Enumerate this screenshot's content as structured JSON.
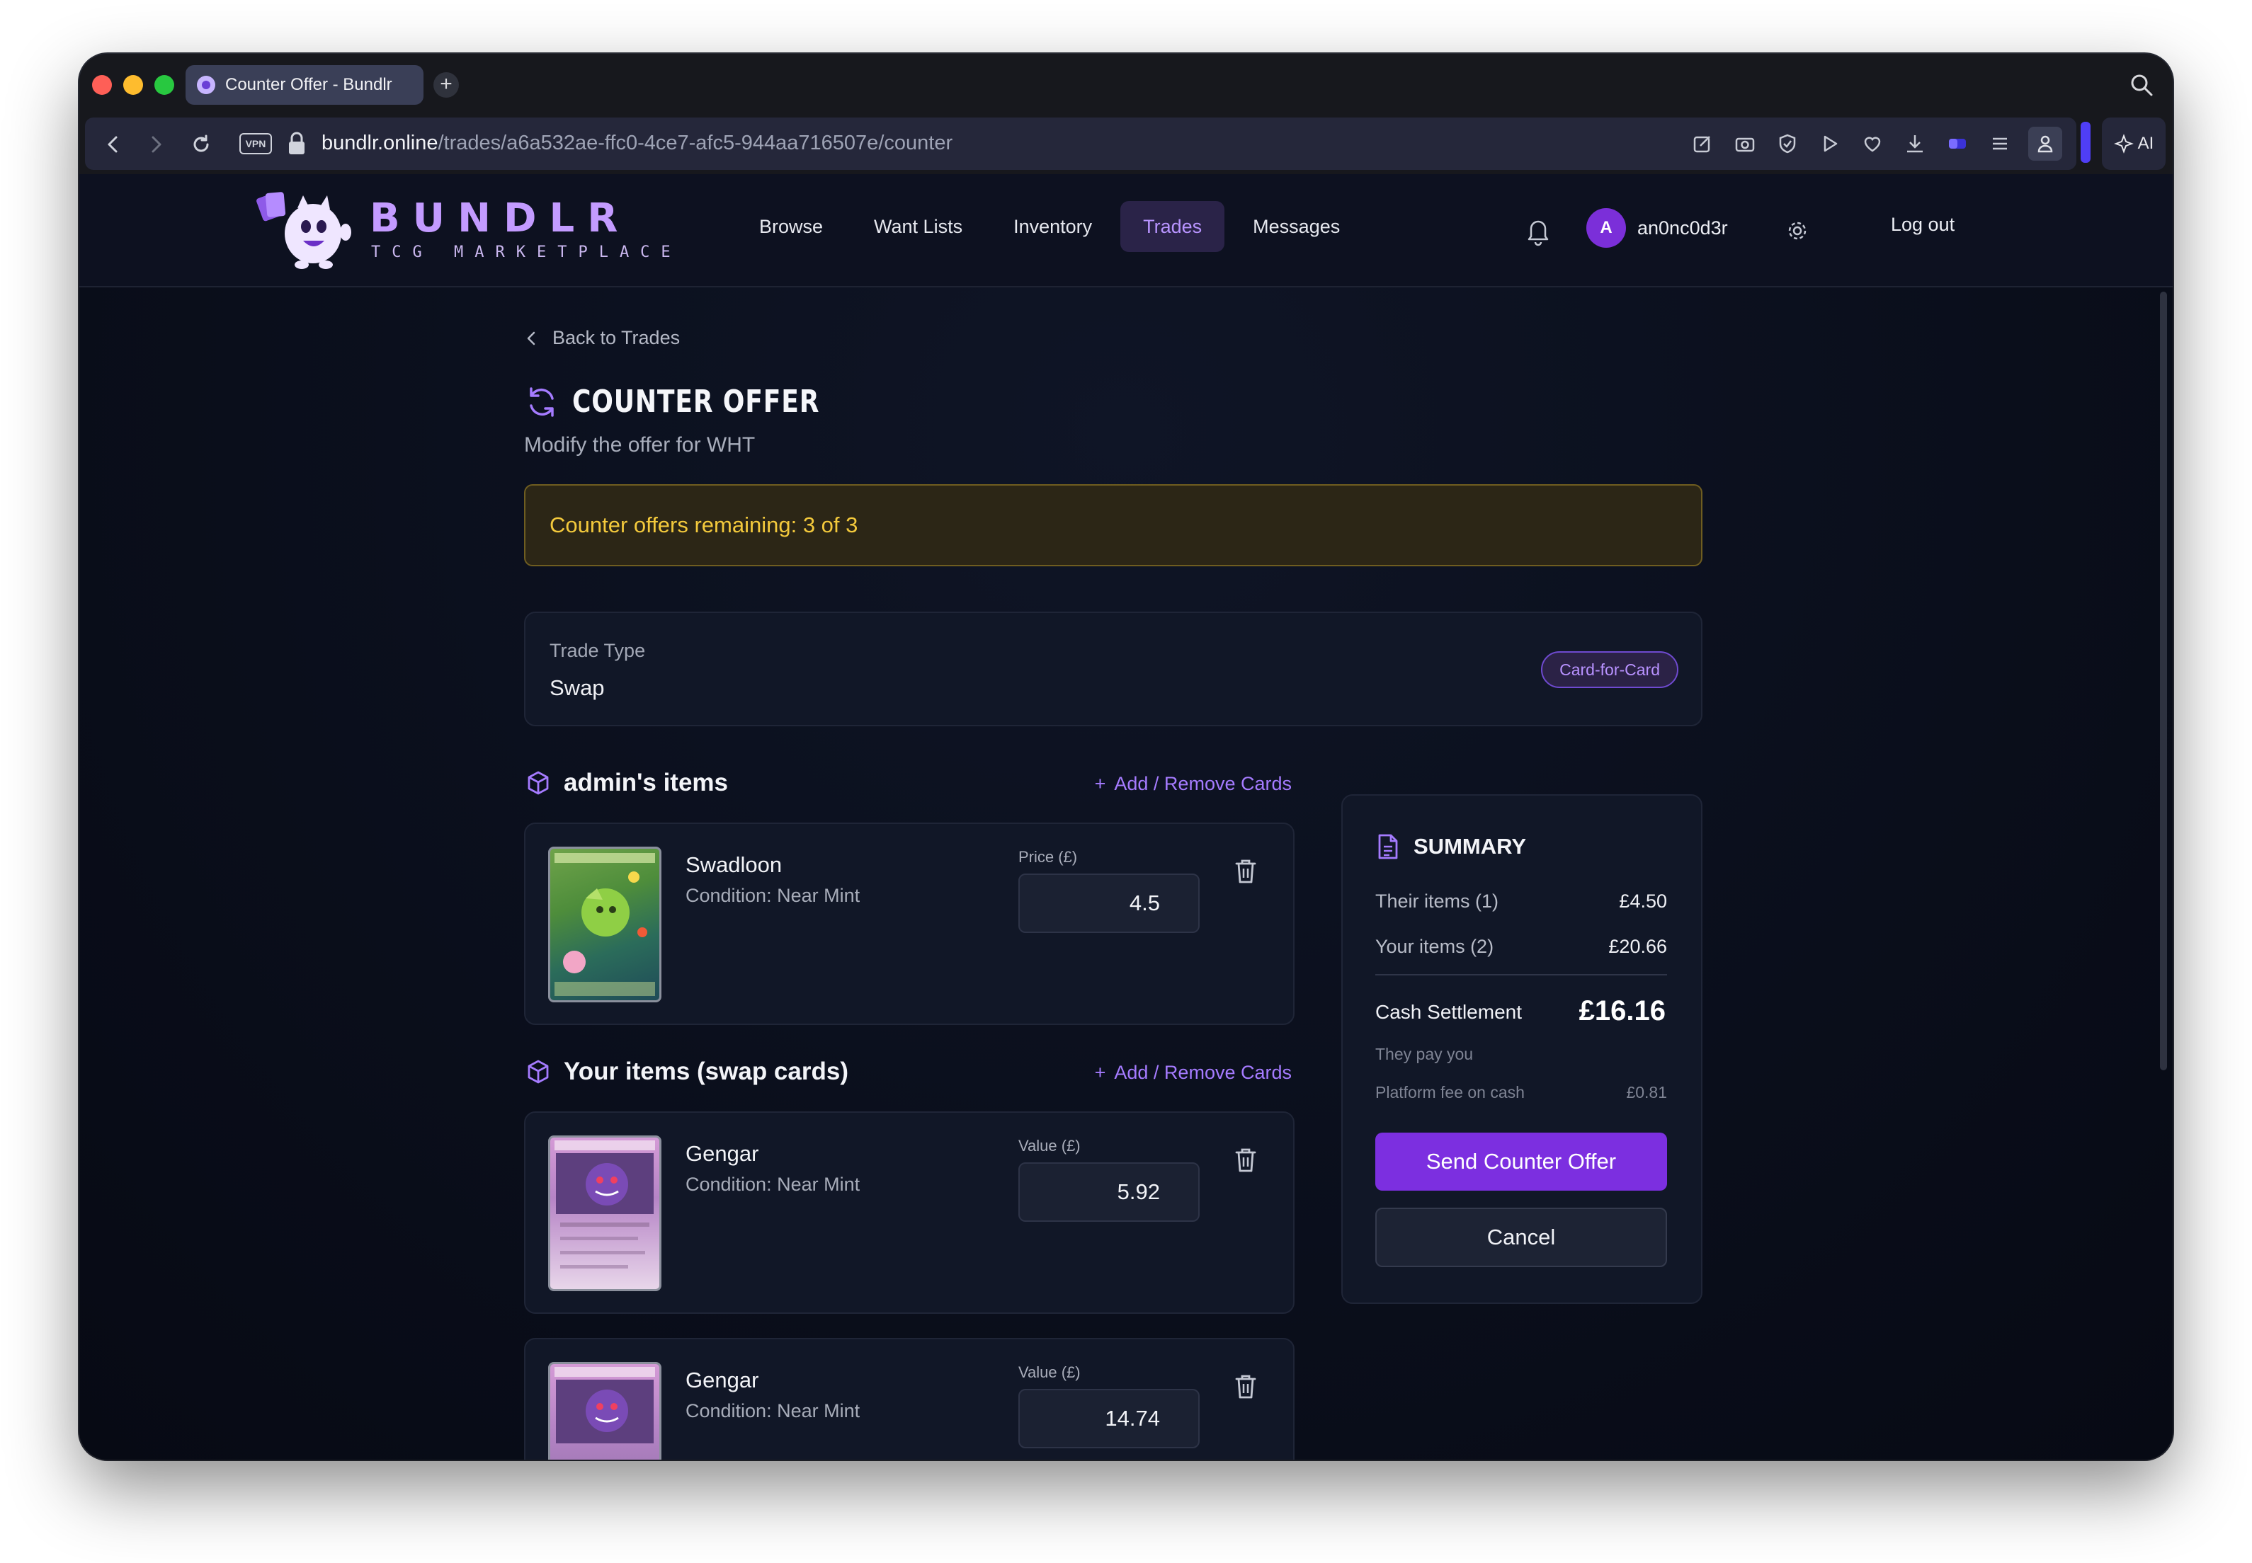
{
  "browser": {
    "tab_title": "Counter Offer - Bundlr",
    "url_host": "bundlr.online",
    "url_path": "/trades/a6a532ae-ffc0-4ce7-afc5-944aa716507e/counter",
    "vpn_label": "VPN",
    "ai_label": "AI"
  },
  "header": {
    "brand": "BUNDLR",
    "tagline": "TCG MARKETPLACE",
    "nav": [
      {
        "label": "Browse"
      },
      {
        "label": "Want Lists"
      },
      {
        "label": "Inventory"
      },
      {
        "label": "Trades",
        "active": true
      },
      {
        "label": "Messages"
      }
    ],
    "avatar_initial": "A",
    "username": "an0nc0d3r",
    "logout": "Log out"
  },
  "page": {
    "back_label": "Back to Trades",
    "title": "COUNTER OFFER",
    "subtitle": "Modify the offer for WHT",
    "notice": "Counter offers remaining: 3 of 3"
  },
  "trade_type": {
    "label": "Trade Type",
    "value": "Swap",
    "badge": "Card-for-Card"
  },
  "their_section": {
    "title": "admin's items",
    "link": "Add / Remove Cards",
    "items": [
      {
        "name": "Swadloon",
        "condition": "Condition: Near Mint",
        "field_label": "Price (£)",
        "value": "4.5"
      }
    ]
  },
  "your_section": {
    "title": "Your items (swap cards)",
    "link": "Add / Remove Cards",
    "items": [
      {
        "name": "Gengar",
        "condition": "Condition: Near Mint",
        "field_label": "Value (£)",
        "value": "5.92"
      },
      {
        "name": "Gengar",
        "condition": "Condition: Near Mint",
        "field_label": "Value (£)",
        "value": "14.74"
      }
    ]
  },
  "summary": {
    "title": "SUMMARY",
    "their_label": "Their items (1)",
    "their_value": "£4.50",
    "your_label": "Your items (2)",
    "your_value": "£20.66",
    "cash_label": "Cash Settlement",
    "cash_value": "£16.16",
    "cash_sub": "They pay you",
    "fee_label": "Platform fee on cash",
    "fee_value": "£0.81",
    "send_button": "Send Counter Offer",
    "cancel_button": "Cancel"
  },
  "colors": {
    "accent": "#7c2fe0",
    "accent_text": "#a57bff",
    "notice_text": "#f3c93c",
    "background": "#0b0f1c"
  },
  "icons": [
    "search-icon",
    "back-icon",
    "forward-icon",
    "reload-icon",
    "lock-icon",
    "bell-icon",
    "gear-icon",
    "refresh-icon",
    "cube-icon",
    "plus-icon",
    "trash-icon",
    "document-icon",
    "chevron-left-icon"
  ]
}
